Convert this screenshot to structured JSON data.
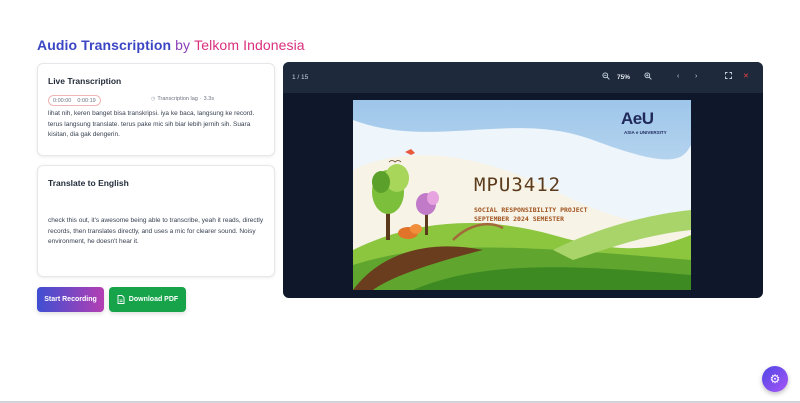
{
  "header": {
    "title_main": "Audio Transcription",
    "title_by": "by",
    "title_org": "Telkom Indonesia"
  },
  "live": {
    "title": "Live Transcription",
    "time_start": "0:00:00",
    "time_end": "0:00:19",
    "lag_label": "Transcription lag",
    "lag_value": "3.3s",
    "text": "lihat nih, keren banget bisa transkripsi. iya ke baca, langsung ke record. terus langsung translate. terus pake mic sih biar lebih jernih sih. Suara kisitan, dia gak dengerin."
  },
  "translate": {
    "title": "Translate to English",
    "text": "check this out, it's awesome being able to transcribe, yeah it reads, directly records, then translates directly, and uses a mic for clearer sound. Noisy environment, he doesn't hear it."
  },
  "buttons": {
    "record_label": "Start Recording",
    "pdf_label": "Download PDF"
  },
  "viewer": {
    "page_count": "1 / 15",
    "zoom": "75%",
    "slide": {
      "logo": "AeU",
      "logo_sub": "ASIA e UNIVERSITY",
      "course_code": "MPU3412",
      "line1": "SOCIAL RESPONSIBILITY PROJECT",
      "line2": "SEPTEMBER 2024 SEMESTER"
    }
  },
  "colors": {
    "accent_blue": "#3b46c4",
    "accent_pink": "#d8307e",
    "pdf_green": "#16a34a",
    "viewer_bg": "#0f172a"
  },
  "icons": {
    "zoom_out": "zoom-out-icon",
    "zoom_in": "zoom-in-icon",
    "prev": "chevron-left-icon",
    "next": "chevron-right-icon",
    "fullscreen": "fullscreen-icon",
    "close": "close-icon",
    "settings": "gear-icon",
    "pdf": "document-icon"
  }
}
